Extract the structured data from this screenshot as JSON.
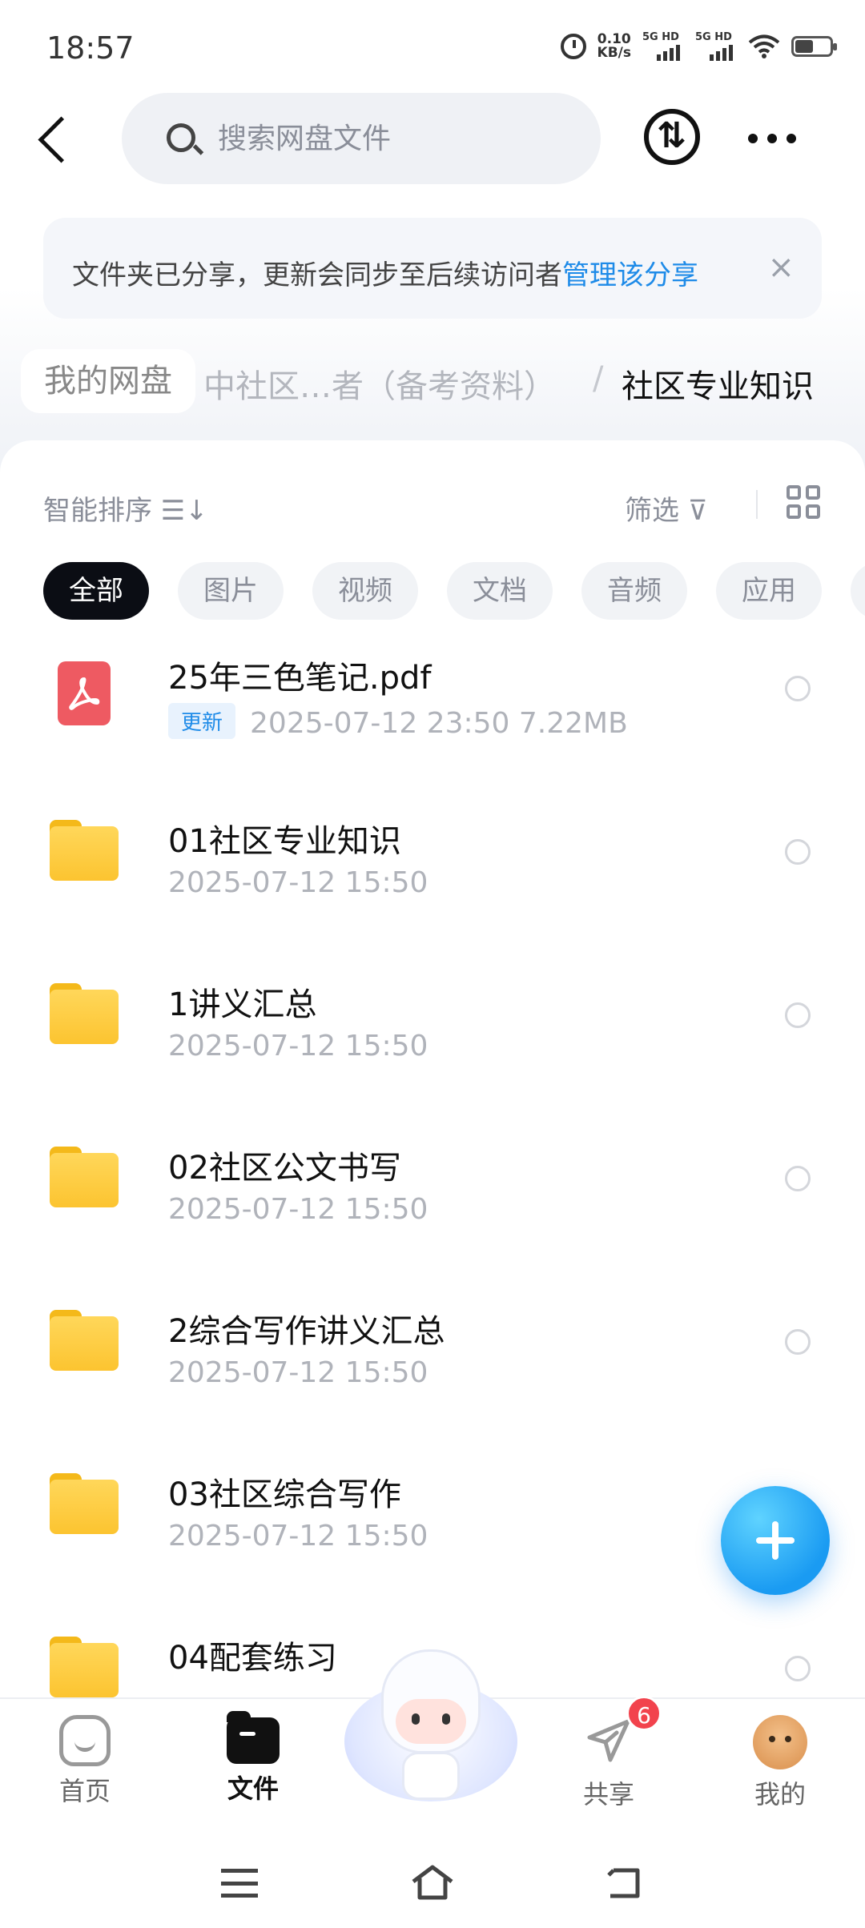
{
  "status_bar": {
    "time": "18:57",
    "speed_value": "0.10",
    "speed_unit": "KB/s",
    "sim1": "5G HD",
    "sim2": "5G HD"
  },
  "header": {
    "search_placeholder": "搜索网盘文件"
  },
  "notice": {
    "text": "文件夹已分享，更新会同步至后续访问者",
    "link": "管理该分享",
    "close": "×"
  },
  "breadcrumb": {
    "root": "我的网盘",
    "middle": "中社区…者（备考资料）",
    "separator": "/",
    "current": "社区专业知识"
  },
  "toolbar": {
    "sort_label": "智能排序 ☰↓",
    "filter_label": "筛选 ⊽"
  },
  "tabs": [
    "全部",
    "图片",
    "视频",
    "文档",
    "音频",
    "应用"
  ],
  "files": [
    {
      "type": "pdf",
      "name": "25年三色笔记.pdf",
      "tag": "更新",
      "meta": "2025-07-12  23:50   7.22MB"
    },
    {
      "type": "folder",
      "name": "01社区专业知识",
      "meta": "2025-07-12  15:50"
    },
    {
      "type": "folder",
      "name": "1讲义汇总",
      "meta": "2025-07-12  15:50"
    },
    {
      "type": "folder",
      "name": "02社区公文书写",
      "meta": "2025-07-12  15:50"
    },
    {
      "type": "folder",
      "name": "2综合写作讲义汇总",
      "meta": "2025-07-12  15:50"
    },
    {
      "type": "folder",
      "name": "03社区综合写作",
      "meta": "2025-07-12  15:50"
    },
    {
      "type": "folder",
      "name": "04配套练习",
      "meta": ""
    }
  ],
  "bottom_nav": {
    "home": "首页",
    "files": "文件",
    "share": "共享",
    "share_badge": "6",
    "me": "我的"
  },
  "colors": {
    "accent": "#1e8be8",
    "active_tab": "#0b0d14",
    "folder": "#fcc430",
    "pdf": "#ee5a62",
    "badge": "#f2434d"
  }
}
